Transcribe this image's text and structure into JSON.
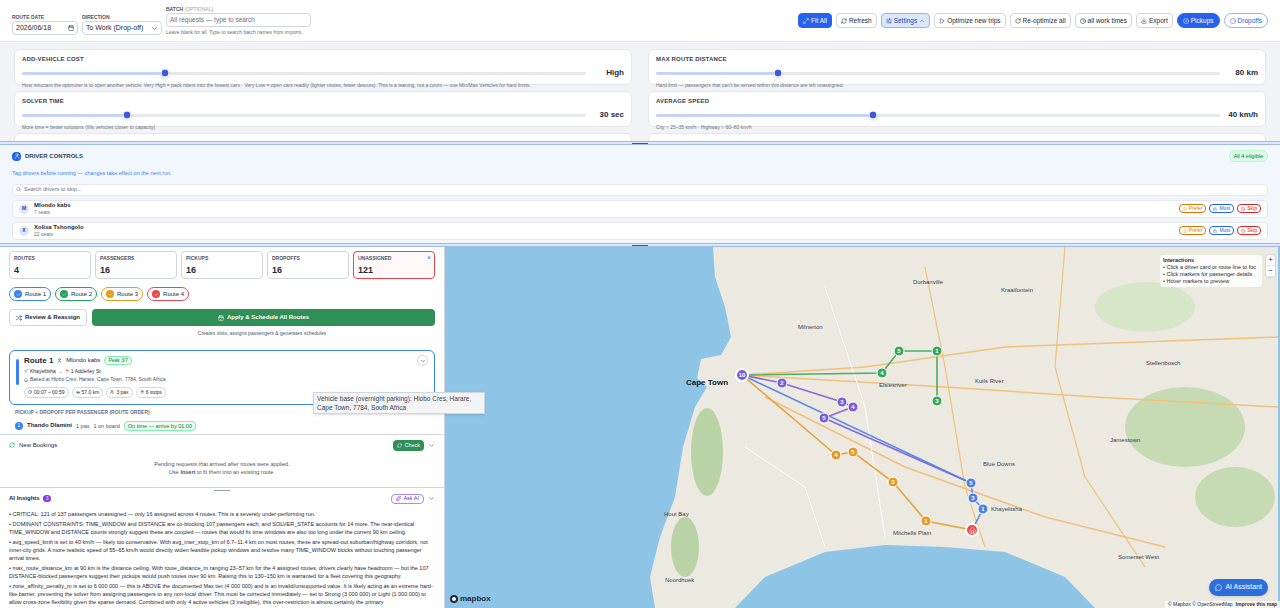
{
  "toolbar": {
    "route_date": {
      "label": "ROUTE DATE",
      "value": "2026/06/18"
    },
    "direction": {
      "label": "DIRECTION",
      "value": "To Work (Drop-off)"
    },
    "batch": {
      "label": "BATCH",
      "hint": "(OPTIONAL)",
      "placeholder": "All requests — type to search",
      "help": "Leave blank for all. Type to search batch names from imports."
    },
    "buttons": [
      {
        "label": "Fit All",
        "kind": "primary",
        "active": false
      },
      {
        "label": "Refresh",
        "kind": "outline",
        "active": false
      },
      {
        "label": "Settings",
        "kind": "toggle",
        "active": true
      },
      {
        "label": "Optimize new trips",
        "kind": "outline",
        "active": false
      },
      {
        "label": "Re-optimize all",
        "kind": "outline",
        "active": false
      },
      {
        "label": "all work times",
        "kind": "outline",
        "active": false
      },
      {
        "label": "Export",
        "kind": "outline",
        "active": false
      }
    ],
    "view_toggle": [
      {
        "label": "Pickups",
        "selected": true
      },
      {
        "label": "Dropoffs",
        "selected": false
      }
    ]
  },
  "settings": {
    "sliders": [
      {
        "label": "ADD-VEHICLE COST",
        "value": "High",
        "level": 0.254,
        "description": "How reluctant the optimizer is to open another vehicle. Very High = pack riders into the fewest cars · Very Low = open cars readily (lighter routes, fewer detours). This is a leaning, not a count — use Min/Max Vehicles for hard limits."
      },
      {
        "label": "MAX ROUTE DISTANCE",
        "value": "80 km",
        "level": 0.217,
        "description": "Hard limit — passengers that can't be served within this distance are left unassigned."
      },
      {
        "label": "SOLVER TIME",
        "value": "30 sec",
        "level": 0.187,
        "description": "More time = better solutions (fills vehicles closer to capacity)"
      },
      {
        "label": "AVERAGE SPEED",
        "value": "40 km/h",
        "level": 0.385,
        "description": "City ≈ 25–35 km/h · Highway ≈ 60–80 km/h"
      }
    ]
  },
  "driver_controls": {
    "title": "DRIVER CONTROLS",
    "badge": "All 4 eligible",
    "hint": "Tag drivers before running — changes take effect on the next run.",
    "search_placeholder": "Search drivers to skip...",
    "tags": [
      {
        "label": "Prefer",
        "color": "#d97706"
      },
      {
        "label": "Must",
        "color": "#2563eb"
      },
      {
        "label": "Skip",
        "color": "#dc2626"
      }
    ],
    "drivers": [
      {
        "initials": "M",
        "name": "Mlondo kabs",
        "seats": "7 seats"
      },
      {
        "initials": "X",
        "name": "Xolisa Tshongolo",
        "seats": "22 seats"
      }
    ]
  },
  "stats": [
    {
      "label": "ROUTES",
      "value": "4",
      "alert": false
    },
    {
      "label": "PASSENGERS",
      "value": "16",
      "alert": false
    },
    {
      "label": "PICKUPS",
      "value": "16",
      "alert": false
    },
    {
      "label": "DROPOFFS",
      "value": "16",
      "alert": false
    },
    {
      "label": "UNASSIGNED",
      "value": "121",
      "alert": true,
      "dismiss": "×"
    }
  ],
  "route_pills": [
    {
      "label": "Route 1",
      "color": "#3b82f6",
      "selected": true
    },
    {
      "label": "Route 2",
      "color": "#22a35a",
      "selected": true
    },
    {
      "label": "Route 3",
      "color": "#e59a1c",
      "selected": true
    },
    {
      "label": "Route 4",
      "color": "#e5484d",
      "selected": true
    }
  ],
  "actions": {
    "review": "Review & Reassign",
    "apply": "Apply & Schedule All Routes",
    "caption": "Creates slots, assigns passengers & generates schedules"
  },
  "route_card": {
    "title": "Route 1",
    "driver": "Mlondo kabs",
    "peak": "Peak 3/7",
    "origin": "Khayelitsha",
    "arrow": "→",
    "destination": "1 Adderley St",
    "base": "Based at Hlobo Cres, Harare, Cape Town, 7784, South Africa",
    "chips": [
      "00:07 – 00:59",
      "57.0 km",
      "3 pax",
      "6 stops"
    ],
    "color": "#3b82f6",
    "section": "PICKUP + DROPOFF PER PASSENGER (ROUTE ORDER)",
    "passengers": [
      {
        "order": "1",
        "name": "Thando Dlamini",
        "pax": "1 pax",
        "status": "1 on board",
        "badge": "On time — arrive by 01:00"
      }
    ]
  },
  "tooltip": "Vehicle base (overnight parking): Hlobo Cres, Harare, Cape Town, 7784, South Africa",
  "new_bookings": {
    "title": "New Bookings",
    "button": "Check",
    "line1": "Pending requests that arrived after routes were applied.",
    "line2": {
      "pre": "Use",
      "em": "Insert",
      "post": "to fit them into an existing route."
    }
  },
  "ai_insights": {
    "title": "AI Insights",
    "count": "3",
    "button": "Ask AI",
    "items": [
      "• CRITICAL: 121 of 137 passengers unassigned — only 16 assigned across 4 routes. This is a severely under-performing run.",
      "• DOMINANT CONSTRAINTS: TIME_WINDOW and DISTANCE are co-blocking 107 passengers each, and SOLVER_STATE accounts for 14 more. The near-identical TIME_WINDOW and DISTANCE counts strongly suggest these are coupled — routes that would fix time windows are also too long under the current 90 km ceiling.",
      "• avg_speed_kmh is set to 40 km/h — likely too conservative. With avg_inter_stop_km of 6.7–11.4 km on most routes, these are spread-out suburban/highway corridors, not inner-city grids. A more realistic speed of 55–65 km/h would directly widen feasible pickup windows and resolve many TIME_WINDOW blocks without touching passenger arrival times.",
      "• max_route_distance_km at 90 km is the distance ceiling. With route_distance_m ranging 23–57 km for the 4 assigned routes, drivers clearly have headroom — but the 107 DISTANCE-blocked passengers suggest their pickups would push routes over 90 km. Raising this to 130–150 km is warranted for a fleet covering this geography.",
      "• zone_affinity_penalty_m is set to 6 000 000 — this is ABOVE the documented Max tier (4 000 000) and is an invalid/unsupported value. It is likely acting as an extreme hard-like barrier, preventing the solver from assigning passengers to any non-local driver. This must be corrected immediately — set to Strong (3 000 000) or Light (1 000 000) to allow cross-zone flexibility given the sparse demand. Combined with only 4 active vehicles (3 ineligible), this over-restriction is almost certainly the primary"
    ]
  },
  "map": {
    "labels": [
      {
        "text": "Durbanville",
        "kind": "suburb"
      },
      {
        "text": "Kraaifontein",
        "kind": "suburb"
      },
      {
        "text": "Milnerton",
        "kind": "suburb"
      },
      {
        "text": "Cape Town",
        "kind": "city"
      },
      {
        "text": "Elsiesriver",
        "kind": "suburb"
      },
      {
        "text": "Kuils River",
        "kind": "suburb"
      },
      {
        "text": "Stellenbosch",
        "kind": "suburb"
      },
      {
        "text": "Blue Downs",
        "kind": "suburb"
      },
      {
        "text": "Jamestown",
        "kind": "suburb"
      },
      {
        "text": "Hout Bay",
        "kind": "suburb"
      },
      {
        "text": "Mitchells Plain",
        "kind": "suburb"
      },
      {
        "text": "Khayelitsha",
        "kind": "suburb"
      },
      {
        "text": "Noordhoek",
        "kind": "suburb"
      },
      {
        "text": "Somerset West",
        "kind": "suburb"
      }
    ],
    "hub": {
      "label": "10",
      "color": "#7b5cd6"
    },
    "routes": [
      {
        "color": "#7b5cd6",
        "stops": [
          "2",
          "3",
          "4",
          "5"
        ]
      },
      {
        "color": "#3aa65a",
        "stops": [
          "4",
          "5",
          "1",
          "3"
        ]
      },
      {
        "color": "#4a7fe6",
        "stops": [
          "5",
          "3",
          "1"
        ]
      },
      {
        "color": "#e49a2b",
        "stops": [
          "4",
          "5",
          "3",
          "1"
        ]
      }
    ],
    "home_color": "#e5484d",
    "interactions": {
      "title": "Interactions",
      "items": [
        "• Click a driver card or route line to foc",
        "• Click markers for passenger details",
        "• Hover markers to preview"
      ]
    },
    "zoom": [
      "+",
      "−"
    ],
    "assistant": "AI Assistant",
    "attribution": "© Mapbox © OpenStreetMap",
    "improve": "Improve this map",
    "logo": "mapbox"
  }
}
